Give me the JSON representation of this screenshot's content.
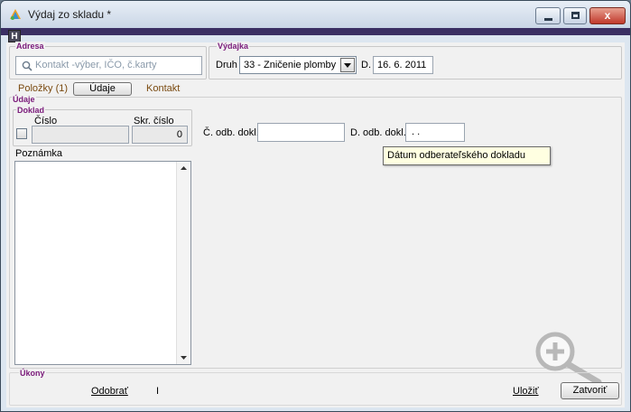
{
  "window": {
    "title": "Výdaj zo skladu *",
    "close_glyph": "x"
  },
  "toolbar": {
    "h_button": "H"
  },
  "address": {
    "group_title": "Adresa",
    "contact_placeholder": "Kontakt -výber, IČO, č.karty"
  },
  "vydajka": {
    "group_title": "Výdajka",
    "druh_label": "Druh",
    "druh_value": "33 - Zničenie plomby",
    "date_label": "D.",
    "date_value": "16. 6. 2011"
  },
  "tabs": {
    "polozky": "Položky (1)",
    "udaje": "Údaje",
    "kontakt": "Kontakt"
  },
  "udaje": {
    "section_title": "Údaje",
    "doklad_title": "Doklad",
    "cislo_label": "Číslo",
    "skr_cislo_label": "Skr. číslo",
    "cislo_value": "",
    "skr_cislo_value": "0",
    "c_odb_label": "Č. odb. dokl.",
    "c_odb_value": "",
    "d_odb_label": "D. odb. dokl.",
    "d_odb_value": " .  .",
    "tooltip": "Dátum odberateľského dokladu",
    "poznamka_label": "Poznámka",
    "poznamka_value": ""
  },
  "ukony": {
    "group_title": "Úkony",
    "odobrat": "Odobrať",
    "separator": "I",
    "ulozit": "Uložiť",
    "zatvorit": "Zatvoriť"
  }
}
